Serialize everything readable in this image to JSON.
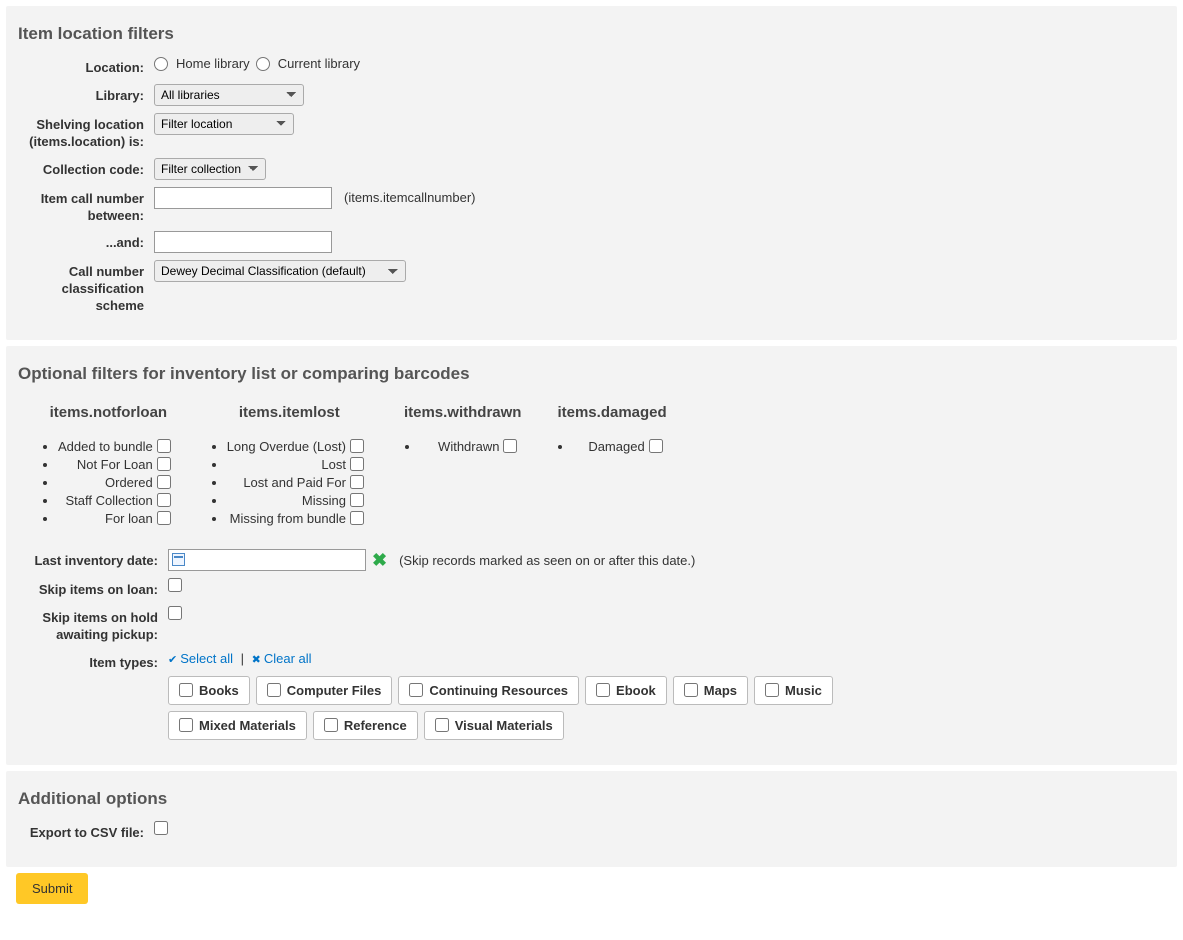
{
  "section1": {
    "legend": "Item location filters",
    "location_label": "Location:",
    "radio_home": "Home library",
    "radio_current": "Current library",
    "library_label": "Library:",
    "library_selected": "All libraries",
    "shelving_label": "Shelving location (items.location) is:",
    "shelving_selected": "Filter location",
    "collection_label": "Collection code:",
    "collection_selected": "Filter collection",
    "callnum_label": "Item call number between:",
    "callnum_hint": "(items.itemcallnumber)",
    "and_label": "...and:",
    "scheme_label": "Call number classification scheme",
    "scheme_selected": "Dewey Decimal Classification (default)"
  },
  "section2": {
    "legend": "Optional filters for inventory list or comparing barcodes",
    "col1_head": "items.notforloan",
    "col2_head": "items.itemlost",
    "col3_head": "items.withdrawn",
    "col4_head": "items.damaged",
    "col1_items": [
      "Added to bundle",
      "Not For Loan",
      "Ordered",
      "Staff Collection",
      "For loan"
    ],
    "col2_items": [
      "Long Overdue (Lost)",
      "Lost",
      "Lost and Paid For",
      "Missing",
      "Missing from bundle"
    ],
    "col3_items": [
      "Withdrawn"
    ],
    "col4_items": [
      "Damaged"
    ],
    "lastinv_label": "Last inventory date:",
    "lastinv_hint": "(Skip records marked as seen on or after this date.)",
    "skip_loan_label": "Skip items on loan:",
    "skip_hold_label": "Skip items on hold awaiting pickup:",
    "itemtypes_label": "Item types:",
    "select_all": "Select all",
    "clear_all": "Clear all",
    "itemtypes": [
      "Books",
      "Computer Files",
      "Continuing Resources",
      "Ebook",
      "Maps",
      "Music",
      "Mixed Materials",
      "Reference",
      "Visual Materials"
    ]
  },
  "section3": {
    "legend": "Additional options",
    "export_label": "Export to CSV file:"
  },
  "submit": "Submit"
}
